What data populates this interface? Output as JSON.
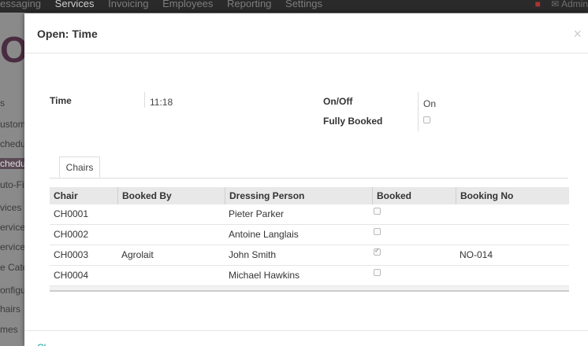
{
  "background": {
    "top_menu": [
      "essaging",
      "Services",
      "Invoicing",
      "Employees",
      "Reporting",
      "Settings"
    ],
    "active_menu": "Services",
    "user_label": "Admin",
    "sidebar_items": [
      "s",
      "ustom",
      "chedul",
      "chedul",
      "uto-Fil",
      "vices",
      "ervices",
      "ervice",
      "e Cate",
      "onfigura",
      "hairs",
      "mes"
    ]
  },
  "modal": {
    "title": "Open: Time",
    "close_glyph": "×",
    "fields": {
      "time_label": "Time",
      "time_value": "11:18",
      "onoff_label": "On/Off",
      "onoff_value": "On",
      "fully_booked_label": "Fully Booked",
      "fully_booked_checked": false
    },
    "tabs": [
      {
        "label": "Chairs"
      }
    ],
    "table": {
      "columns": [
        "Chair",
        "Booked By",
        "Dressing Person",
        "Booked",
        "Booking No"
      ],
      "rows": [
        {
          "chair": "CH0001",
          "booked_by": "",
          "dressing_person": "Pieter Parker",
          "booked": false,
          "booking_no": ""
        },
        {
          "chair": "CH0002",
          "booked_by": "",
          "dressing_person": "Antoine Langlais",
          "booked": false,
          "booking_no": ""
        },
        {
          "chair": "CH0003",
          "booked_by": "Agrolait",
          "dressing_person": "John Smith",
          "booked": true,
          "booking_no": "NO-014"
        },
        {
          "chair": "CH0004",
          "booked_by": "",
          "dressing_person": "Michael Hawkins",
          "booked": false,
          "booking_no": ""
        }
      ]
    },
    "footer_link": "Cl"
  }
}
